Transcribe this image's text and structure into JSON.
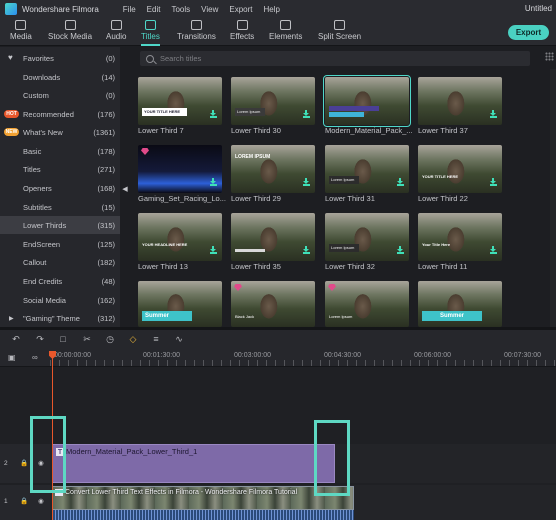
{
  "app": {
    "name": "Wondershare Filmora",
    "window_title": "Untitled"
  },
  "menu": [
    "File",
    "Edit",
    "Tools",
    "View",
    "Export",
    "Help"
  ],
  "toolbar": {
    "tabs": [
      "Media",
      "Stock Media",
      "Audio",
      "Titles",
      "Transitions",
      "Effects",
      "Elements",
      "Split Screen"
    ],
    "active_tab": "Titles",
    "export_label": "Export"
  },
  "sidebar": {
    "items": [
      {
        "label": "Favorites",
        "count": "(0)"
      },
      {
        "label": "Downloads",
        "count": "(14)"
      },
      {
        "label": "Custom",
        "count": "(0)"
      },
      {
        "label": "Recommended",
        "count": "(176)",
        "badge": "HOT"
      },
      {
        "label": "What's New",
        "count": "(1361)",
        "badge": "NEW"
      },
      {
        "label": "Basic",
        "count": "(178)"
      },
      {
        "label": "Titles",
        "count": "(271)"
      },
      {
        "label": "Openers",
        "count": "(168)"
      },
      {
        "label": "Subtitles",
        "count": "(15)"
      },
      {
        "label": "Lower Thirds",
        "count": "(315)"
      },
      {
        "label": "EndScreen",
        "count": "(125)"
      },
      {
        "label": "Callout",
        "count": "(182)"
      },
      {
        "label": "End Credits",
        "count": "(48)"
      },
      {
        "label": "Social Media",
        "count": "(162)"
      },
      {
        "label": "\"Gaming\" Theme",
        "count": "(312)"
      }
    ],
    "active": "Lower Thirds"
  },
  "search": {
    "placeholder": "Search titles"
  },
  "titles": [
    {
      "label": "Lower Third 7"
    },
    {
      "label": "Lower Third 30"
    },
    {
      "label": "Modern_Material_Pack_...",
      "selected": true
    },
    {
      "label": "Lower Third 37"
    },
    {
      "label": "Gaming_Set_Racing_Lo...",
      "premium": true
    },
    {
      "label": "Lower Third 29"
    },
    {
      "label": "Lower Third 31"
    },
    {
      "label": "Lower Third 22"
    },
    {
      "label": "Lower Third 13"
    },
    {
      "label": "Lower Third 35"
    },
    {
      "label": "Lower Third 32"
    },
    {
      "label": "Lower Third 11"
    },
    {
      "label": "",
      "premium": false
    },
    {
      "label": "",
      "premium": true
    },
    {
      "label": "",
      "premium": true
    },
    {
      "label": ""
    }
  ],
  "tile_texts": {
    "t1": "YOUR TITLE HERE",
    "t2": "Lorem Ipsum",
    "t6": "LOREM IPSUM",
    "t7": "Lorem Ipsum",
    "t8": "YOUR TITLE HERE",
    "t9": "YOUR HEADLINE HERE",
    "t11": "Lorem Ipsum",
    "t12": "Your Title Here",
    "t13": "Summer",
    "t14": "Black Jack",
    "t15": "Lorem Ipsum",
    "t16": "Summer"
  },
  "timeline": {
    "timecodes": [
      "00:00:00:00",
      "00:01:30:00",
      "00:03:00:00",
      "00:04:30:00",
      "00:06:00:00",
      "00:07:30:00"
    ],
    "title_clip": "Modern_Material_Pack_Lower_Third_1",
    "video_clip": "Convert Lower Third Text Effects in Filmora - Wondershare Filmora Tutorial",
    "track_labels": [
      "2",
      "1"
    ]
  },
  "colors": {
    "accent": "#4fd7c9",
    "playhead": "#e8572b",
    "title_clip": "#7e6aa8",
    "highlight": "#5ed8c3"
  }
}
